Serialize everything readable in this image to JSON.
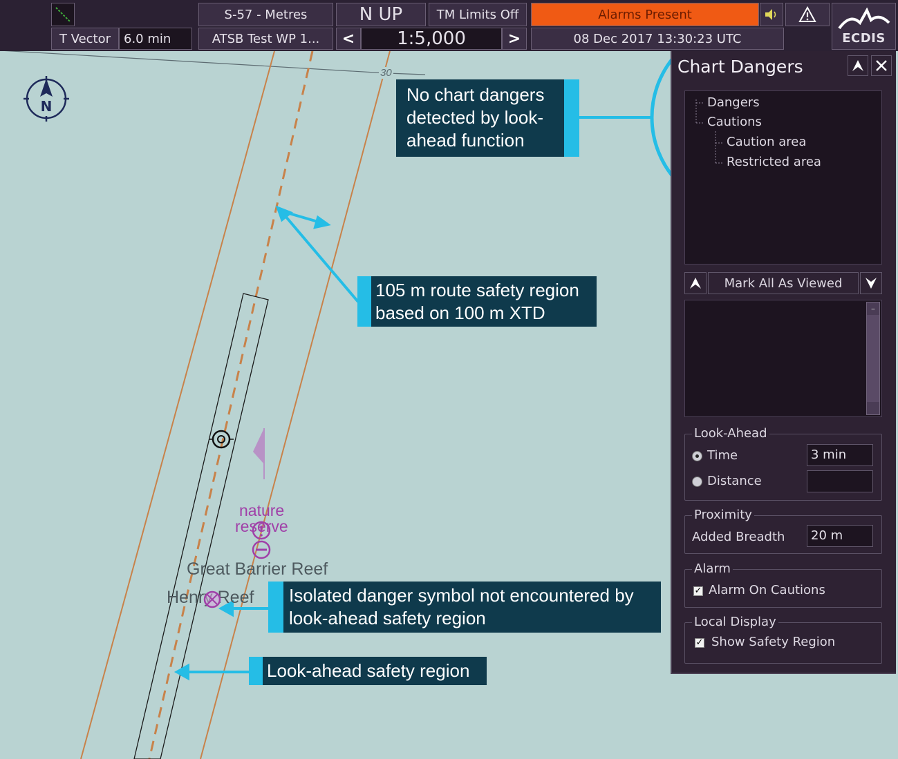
{
  "topbar": {
    "depth_units": "S-57 - Metres",
    "orientation": "N UP",
    "tm_limits": "TM Limits Off",
    "alarms": "Alarms Present",
    "vector_label": "T Vector",
    "vector_value": "6.0 min",
    "route_name": "ATSB Test WP 1...",
    "scale": "1:5,000",
    "datetime": "08 Dec 2017 13:30:23 UTC",
    "brand": "ECDIS",
    "prev_arrow": "<",
    "next_arrow": ">"
  },
  "chart": {
    "contour_label": "30",
    "compass_letter": "N",
    "labels": {
      "nature": "nature",
      "reserve": "reserve",
      "reef": "Great Barrier Reef",
      "henry": "Henry Reef"
    }
  },
  "panel": {
    "title": "Chart Dangers",
    "tree": {
      "dangers": "Dangers",
      "cautions": "Cautions",
      "caution_area": "Caution area",
      "restricted_area": "Restricted area"
    },
    "mark_all": "Mark All As Viewed",
    "look_ahead": {
      "legend": "Look-Ahead",
      "time_label": "Time",
      "time_value": "3 min",
      "distance_label": "Distance",
      "distance_value": "",
      "selected": "time"
    },
    "proximity": {
      "legend": "Proximity",
      "label": "Added Breadth",
      "value": "20 m"
    },
    "alarm": {
      "legend": "Alarm",
      "label": "Alarm On Cautions",
      "checked": true
    },
    "local_display": {
      "legend": "Local Display",
      "label": "Show Safety Region",
      "checked": true
    }
  },
  "callouts": {
    "no_dangers": "No chart dangers detected by look-ahead function",
    "route_region": "105 m route safety region based on 100 m XTD",
    "isolated": "Isolated danger symbol not encountered by look-ahead safety region",
    "lookahead": "Look-ahead safety region"
  },
  "colors": {
    "sea": "#b9d3d2",
    "callout_bg": "#0f3a4c",
    "callout_accent": "#25bde6",
    "alarm": "#f05a14",
    "route": "#c8824a",
    "magenta": "#a040a8"
  }
}
